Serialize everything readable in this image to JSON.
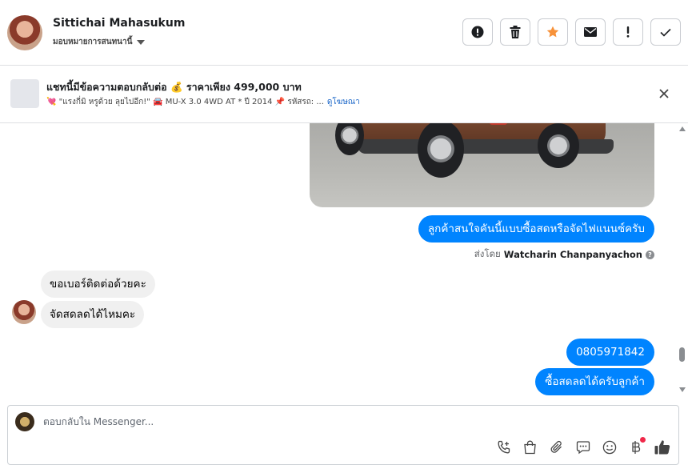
{
  "header": {
    "contact_name": "Sittichai Mahasukum",
    "assign_label": "มอบหมายการสนทนานี้",
    "actions": [
      {
        "icon": "alert-circle-icon",
        "name": "mark-spam-button"
      },
      {
        "icon": "trash-icon",
        "name": "delete-button"
      },
      {
        "icon": "star-icon",
        "name": "star-button"
      },
      {
        "icon": "envelope-icon",
        "name": "mark-unread-button"
      },
      {
        "icon": "exclamation-icon",
        "name": "follow-up-button"
      },
      {
        "icon": "check-icon",
        "name": "mark-done-button"
      }
    ],
    "star_color": "#f7923a"
  },
  "ad_banner": {
    "title": "แชทนี้มีข้อความตอบกลับต่อ 💰 ราคาเพียง 499,000 บาท",
    "subtitle": "💘 \"แรงกี่มิ หรูด้วย ลุยไปอีก!\" 🚘 MU-X 3.0 4WD AT * ปี 2014 📌 รหัสรถ: ...",
    "link_label": "ดูโฆษณา"
  },
  "conversation": {
    "messages": [
      {
        "direction": "out",
        "text": "ลูกค้าสนใจคันนี้แบบซื้อสดหรือจัดไฟแนนซ์ครับ"
      },
      {
        "direction": "in",
        "text": "ขอเบอร์ติดต่อด้วยคะ"
      },
      {
        "direction": "in",
        "text": "จัดสดลดได้ไหมคะ"
      },
      {
        "direction": "out",
        "text": "0805971842"
      },
      {
        "direction": "out",
        "text": "ซื้อสดลดได้ครับลูกค้า"
      }
    ],
    "sent_by_prefix": "ส่งโดย",
    "sent_by_name": "Watcharin Chanpanyachon",
    "help_glyph": "?"
  },
  "composer": {
    "placeholder": "ตอบกลับใน Messenger...",
    "tools": [
      "phone-plus-icon",
      "shopping-bag-icon",
      "paperclip-icon",
      "chat-bubble-icon",
      "smiley-icon",
      "baht-icon",
      "thumbs-up-icon"
    ],
    "accent_color": "#0084ff"
  }
}
